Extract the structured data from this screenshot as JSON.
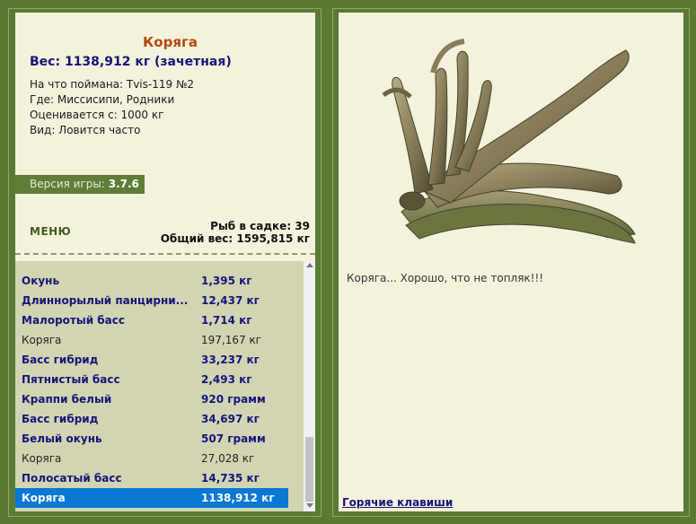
{
  "fish": {
    "title": "Коряга",
    "weight": "Вес: 1138,912 кг (зачетная)",
    "caught_on": "На что поймана: Tvis-119 №2",
    "location": "Где: Миссисипи, Родники",
    "valued_from": "Оценивается с: 1000 кг",
    "kind": "Вид: Ловится часто",
    "image_icon": "driftwood-image"
  },
  "version": {
    "label": "Версия игры: ",
    "value": "3.7.6"
  },
  "menu": {
    "label": "МЕНЮ"
  },
  "keepnet": {
    "count": "Рыб в садке: 39",
    "total": "Общий вес: 1595,815 кг"
  },
  "catch_list": [
    {
      "name": "Окунь",
      "weight": "1,395 кг",
      "style": "bold"
    },
    {
      "name": "Длиннорылый панцирни...",
      "weight": "12,437 кг",
      "style": "bold"
    },
    {
      "name": "Малоротый басс",
      "weight": "1,714 кг",
      "style": "bold"
    },
    {
      "name": "Коряга",
      "weight": "197,167 кг",
      "style": "plain"
    },
    {
      "name": "Басс гибрид",
      "weight": "33,237 кг",
      "style": "bold"
    },
    {
      "name": "Пятнистый басс",
      "weight": "2,493 кг",
      "style": "bold"
    },
    {
      "name": "Краппи белый",
      "weight": "920 грамм",
      "style": "bold"
    },
    {
      "name": "Басс гибрид",
      "weight": "34,697 кг",
      "style": "bold"
    },
    {
      "name": "Белый окунь",
      "weight": "507 грамм",
      "style": "bold"
    },
    {
      "name": "Коряга",
      "weight": "27,028 кг",
      "style": "plain"
    },
    {
      "name": "Полосатый басс",
      "weight": "14,735 кг",
      "style": "bold"
    },
    {
      "name": "Коряга",
      "weight": "1138,912 кг",
      "style": "sel"
    }
  ],
  "message": "Коряга... Хорошо, что не топляк!!!",
  "hotkeys": "Горячие клавиши",
  "colors": {
    "panel_border": "#5a7a33",
    "panel_bg": "#f4f2dc",
    "selection": "#0a78d4",
    "title": "#b3490f",
    "accent_text": "#15157a"
  }
}
